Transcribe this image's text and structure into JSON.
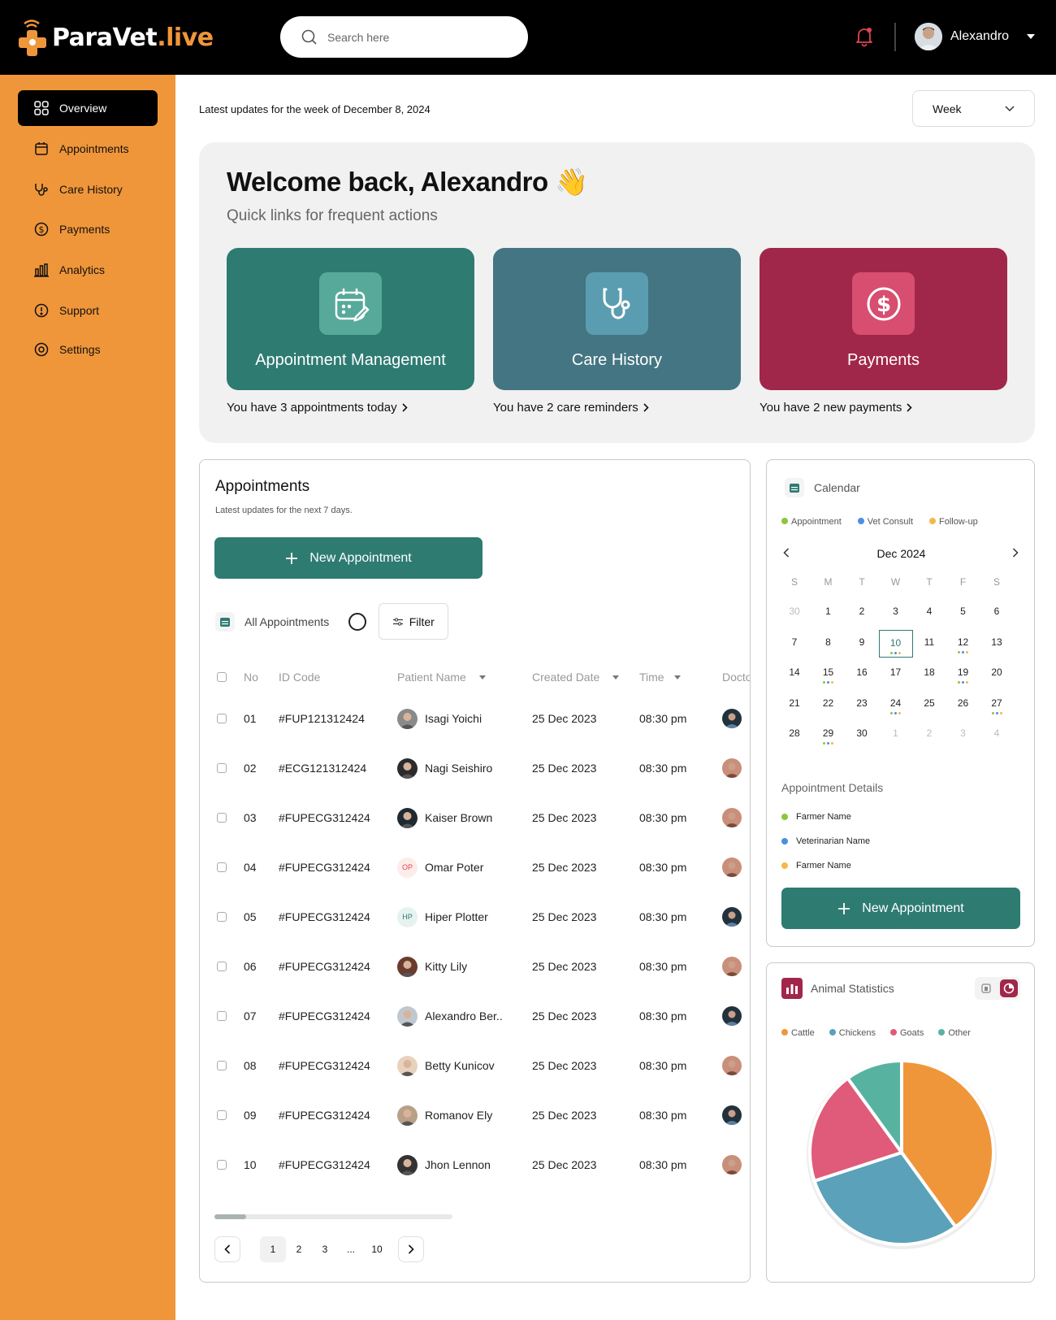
{
  "brand": {
    "name": "ParaVet",
    "suffix": ".live"
  },
  "search": {
    "placeholder": "Search here"
  },
  "user": {
    "name": "Alexandro"
  },
  "sidebar": {
    "items": [
      {
        "label": "Overview",
        "icon": "grid-icon",
        "active": true
      },
      {
        "label": "Appointments",
        "icon": "calendar-icon"
      },
      {
        "label": "Care History",
        "icon": "stethoscope-icon"
      },
      {
        "label": "Payments",
        "icon": "dollar-icon"
      },
      {
        "label": "Analytics",
        "icon": "bar-chart-icon"
      },
      {
        "label": "Support",
        "icon": "info-icon"
      },
      {
        "label": "Settings",
        "icon": "gear-icon"
      }
    ]
  },
  "header": {
    "week_label": "Latest updates for the week of December 8, 2024",
    "period_select": "Week"
  },
  "welcome": {
    "title": "Welcome back, Alexandro 👋",
    "subtitle": "Quick links for frequent actions",
    "cards": [
      {
        "title": "Appointment Management",
        "note": "You have 3 appointments today",
        "color": "#2E7B72",
        "icon": "calendar-edit-icon"
      },
      {
        "title": "Care History",
        "note": "You have 2 care reminders",
        "color": "#447582",
        "icon": "stethoscope-icon"
      },
      {
        "title": "Payments",
        "note": "You have 2 new payments",
        "color": "#A1274A",
        "icon": "dollar-icon"
      }
    ]
  },
  "appointments": {
    "title": "Appointments",
    "subtitle": "Latest updates for the next 7 days.",
    "new_button": "New Appointment",
    "filter_label": "All Appointments",
    "filter_button": "Filter",
    "columns": [
      "No",
      "ID Code",
      "Patient Name",
      "Created Date",
      "Time",
      "Doctor"
    ],
    "rows": [
      {
        "no": "01",
        "id": "#FUP121312424",
        "patient": "Isagi Yoichi",
        "initials": "",
        "date": "25 Dec 2023",
        "time": "08:30 pm"
      },
      {
        "no": "02",
        "id": "#ECG121312424",
        "patient": "Nagi Seishiro",
        "initials": "",
        "date": "25 Dec 2023",
        "time": "08:30 pm"
      },
      {
        "no": "03",
        "id": "#FUPECG312424",
        "patient": "Kaiser Brown",
        "initials": "",
        "date": "25 Dec 2023",
        "time": "08:30 pm"
      },
      {
        "no": "04",
        "id": "#FUPECG312424",
        "patient": "Omar Poter",
        "initials": "OP",
        "date": "25 Dec 2023",
        "time": "08:30 pm"
      },
      {
        "no": "05",
        "id": "#FUPECG312424",
        "patient": "Hiper Plotter",
        "initials": "HP",
        "date": "25 Dec 2023",
        "time": "08:30 pm"
      },
      {
        "no": "06",
        "id": "#FUPECG312424",
        "patient": "Kitty Lily",
        "initials": "",
        "date": "25 Dec 2023",
        "time": "08:30 pm"
      },
      {
        "no": "07",
        "id": "#FUPECG312424",
        "patient": "Alexandro Ber..",
        "initials": "",
        "date": "25 Dec 2023",
        "time": "08:30 pm"
      },
      {
        "no": "08",
        "id": "#FUPECG312424",
        "patient": "Betty Kunicov",
        "initials": "",
        "date": "25 Dec 2023",
        "time": "08:30 pm"
      },
      {
        "no": "09",
        "id": "#FUPECG312424",
        "patient": "Romanov Ely",
        "initials": "",
        "date": "25 Dec 2023",
        "time": "08:30 pm"
      },
      {
        "no": "10",
        "id": "#FUPECG312424",
        "patient": "Jhon Lennon",
        "initials": "",
        "date": "25 Dec 2023",
        "time": "08:30 pm"
      }
    ],
    "pages": [
      "1",
      "2",
      "3",
      "...",
      "10"
    ],
    "current_page": "1"
  },
  "calendar": {
    "title": "Calendar",
    "legend": [
      {
        "label": "Appointment",
        "color": "#8CC63F"
      },
      {
        "label": "Vet Consult",
        "color": "#4A90E2"
      },
      {
        "label": "Follow-up",
        "color": "#F5B94A"
      }
    ],
    "month": "Dec 2024",
    "weekdays": [
      "S",
      "M",
      "T",
      "W",
      "T",
      "F",
      "S"
    ],
    "weeks": [
      [
        "30",
        "1",
        "2",
        "3",
        "4",
        "5",
        "6"
      ],
      [
        "7",
        "8",
        "9",
        "10",
        "11",
        "12",
        "13"
      ],
      [
        "14",
        "15",
        "16",
        "17",
        "18",
        "19",
        "20"
      ],
      [
        "21",
        "22",
        "23",
        "24",
        "25",
        "26",
        "27"
      ],
      [
        "28",
        "29",
        "30",
        "1",
        "2",
        "3",
        "4"
      ]
    ],
    "selected": "10",
    "event_days": [
      "10",
      "12",
      "15",
      "19",
      "24",
      "27",
      "29"
    ],
    "details_title": "Appointment Details",
    "details": [
      {
        "label": "Farmer Name",
        "color": "#8CC63F"
      },
      {
        "label": "Veterinarian Name",
        "color": "#4A90E2"
      },
      {
        "label": "Farmer Name",
        "color": "#F5B94A"
      }
    ],
    "new_button": "New Appointment"
  },
  "animal_stats": {
    "title": "Animal Statistics",
    "legend": [
      {
        "label": "Cattle",
        "color": "#F0963A"
      },
      {
        "label": "Chickens",
        "color": "#5AA1B9"
      },
      {
        "label": "Goats",
        "color": "#E05A7A"
      },
      {
        "label": "Other",
        "color": "#57B3A0"
      }
    ]
  },
  "chart_data": {
    "type": "pie",
    "title": "Animal Statistics",
    "labels": [
      "Cattle",
      "Chickens",
      "Goats",
      "Other"
    ],
    "values": [
      40,
      30,
      20,
      10
    ],
    "colors": [
      "#F0963A",
      "#5AA1B9",
      "#E05A7A",
      "#57B3A0"
    ]
  }
}
